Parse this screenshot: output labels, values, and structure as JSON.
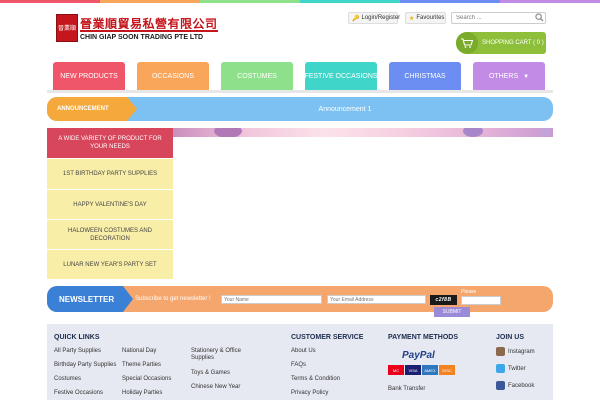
{
  "header": {
    "logo_chars": "晉業順",
    "logo_cn": "晉業順貿易私營有限公司",
    "logo_en": "CHIN GIAP SOON TRADING PTE LTD",
    "login_label": "Login/Register",
    "favourites_label": "Favourites",
    "search_placeholder": "Search ...",
    "cart_label": "SHOPPING CART ( 0 )"
  },
  "nav": {
    "items": [
      {
        "label": "NEW PRODUCTS",
        "color": "#f0566a"
      },
      {
        "label": "OCCASIONS",
        "color": "#f9a65a"
      },
      {
        "label": "COSTUMES",
        "color": "#8ee08a"
      },
      {
        "label": "FESTIVE OCCASIONS",
        "color": "#3fd6c9"
      },
      {
        "label": "CHRISTMAS",
        "color": "#6c8ef2"
      },
      {
        "label": "OTHERS",
        "color": "#c28be6"
      }
    ]
  },
  "announcement": {
    "label": "ANNOUNCEMENT",
    "text": "Announcement 1"
  },
  "sidebar": {
    "header": "A WIDE VARIETY OF PRODUCT FOR YOUR NEEDS",
    "items": [
      {
        "label": "1ST BIRTHDAY PARTY SUPPLIES"
      },
      {
        "label": "HAPPY VALENTINE'S DAY"
      },
      {
        "label": "HALOWEEN COSTUMES AND DECORATION"
      },
      {
        "label": "LUNAR NEW YEAR'S PARTY SET"
      }
    ]
  },
  "newsletter": {
    "label": "NEWSLETTER",
    "text": "Subscribe to get newsletter !",
    "name_placeholder": "Your Name",
    "email_placeholder": "Your Email Address",
    "captcha_text": "c2f8B",
    "captcha_label": "Please",
    "submit_label": "SUBMIT"
  },
  "footer": {
    "quick_links": {
      "title": "QUICK LINKS",
      "col1": [
        "All Party Supplies",
        "Birthday Party Supplies",
        "Costumes",
        "Festive Occasions"
      ],
      "col2": [
        "National Day",
        "Theme Parties",
        "Special Occasions",
        "Holiday Parties"
      ],
      "col3": [
        "Stationery & Office Supplies",
        "Toys & Games",
        "Chinese New Year"
      ]
    },
    "customer_service": {
      "title": "CUSTOMER SERVICE",
      "links": [
        "About Us",
        "FAQs",
        "Terms & Condition",
        "Privacy Policy"
      ]
    },
    "payment": {
      "title": "PAYMENT METHODS",
      "paypal": "PayPal",
      "cards": [
        "MC",
        "VISA",
        "AMEX",
        "DISC"
      ],
      "bank": "Bank Transfer"
    },
    "join": {
      "title": "JOIN US",
      "items": [
        {
          "label": "Instagram",
          "color": "#8a6a4a"
        },
        {
          "label": "Twitter",
          "color": "#3ea7ea"
        },
        {
          "label": "Facebook",
          "color": "#3b5998"
        }
      ]
    }
  },
  "colors": {
    "topstrip": [
      "#f0566a",
      "#f9a65a",
      "#8ee08a",
      "#3fd6c9",
      "#6c8ef2",
      "#c28be6"
    ]
  }
}
